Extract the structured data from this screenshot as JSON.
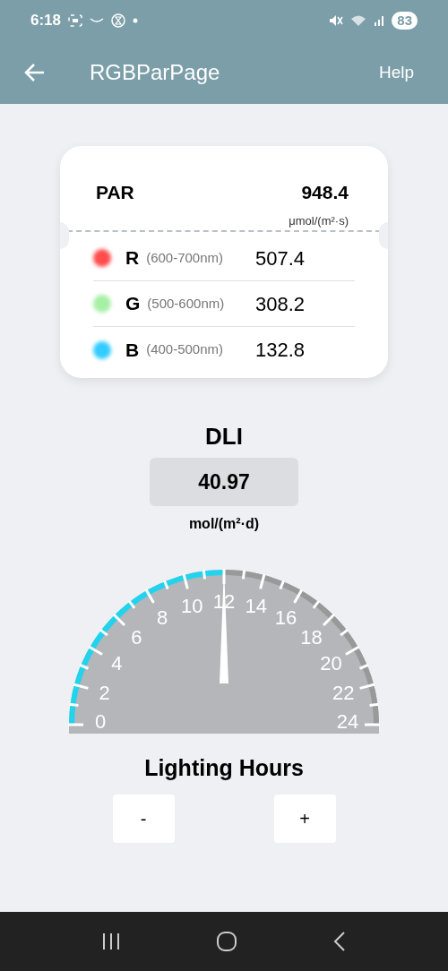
{
  "status_bar": {
    "time": "6:18",
    "battery": "83"
  },
  "app_bar": {
    "title": "RGBParPage",
    "action": "Help"
  },
  "par": {
    "label": "PAR",
    "value": "948.4",
    "unit": "μmol/(m²·s)",
    "channels": [
      {
        "letter": "R",
        "range": "(600-700nm)",
        "value": "507.4",
        "color": "#ff4d4d"
      },
      {
        "letter": "G",
        "range": "(500-600nm)",
        "value": "308.2",
        "color": "#a6f0a6"
      },
      {
        "letter": "B",
        "range": "(400-500nm)",
        "value": "132.8",
        "color": "#33ccff"
      }
    ]
  },
  "dli": {
    "label": "DLI",
    "value": "40.97",
    "unit": "mol/(m²·d)"
  },
  "gauge": {
    "level": 0.5,
    "labels": [
      "0",
      "2",
      "4",
      "6",
      "8",
      "10",
      "12",
      "14",
      "16",
      "18",
      "20",
      "22",
      "24"
    ]
  },
  "lighting_hours": {
    "label": "Lighting Hours",
    "buttons": [
      "-",
      "+"
    ]
  }
}
